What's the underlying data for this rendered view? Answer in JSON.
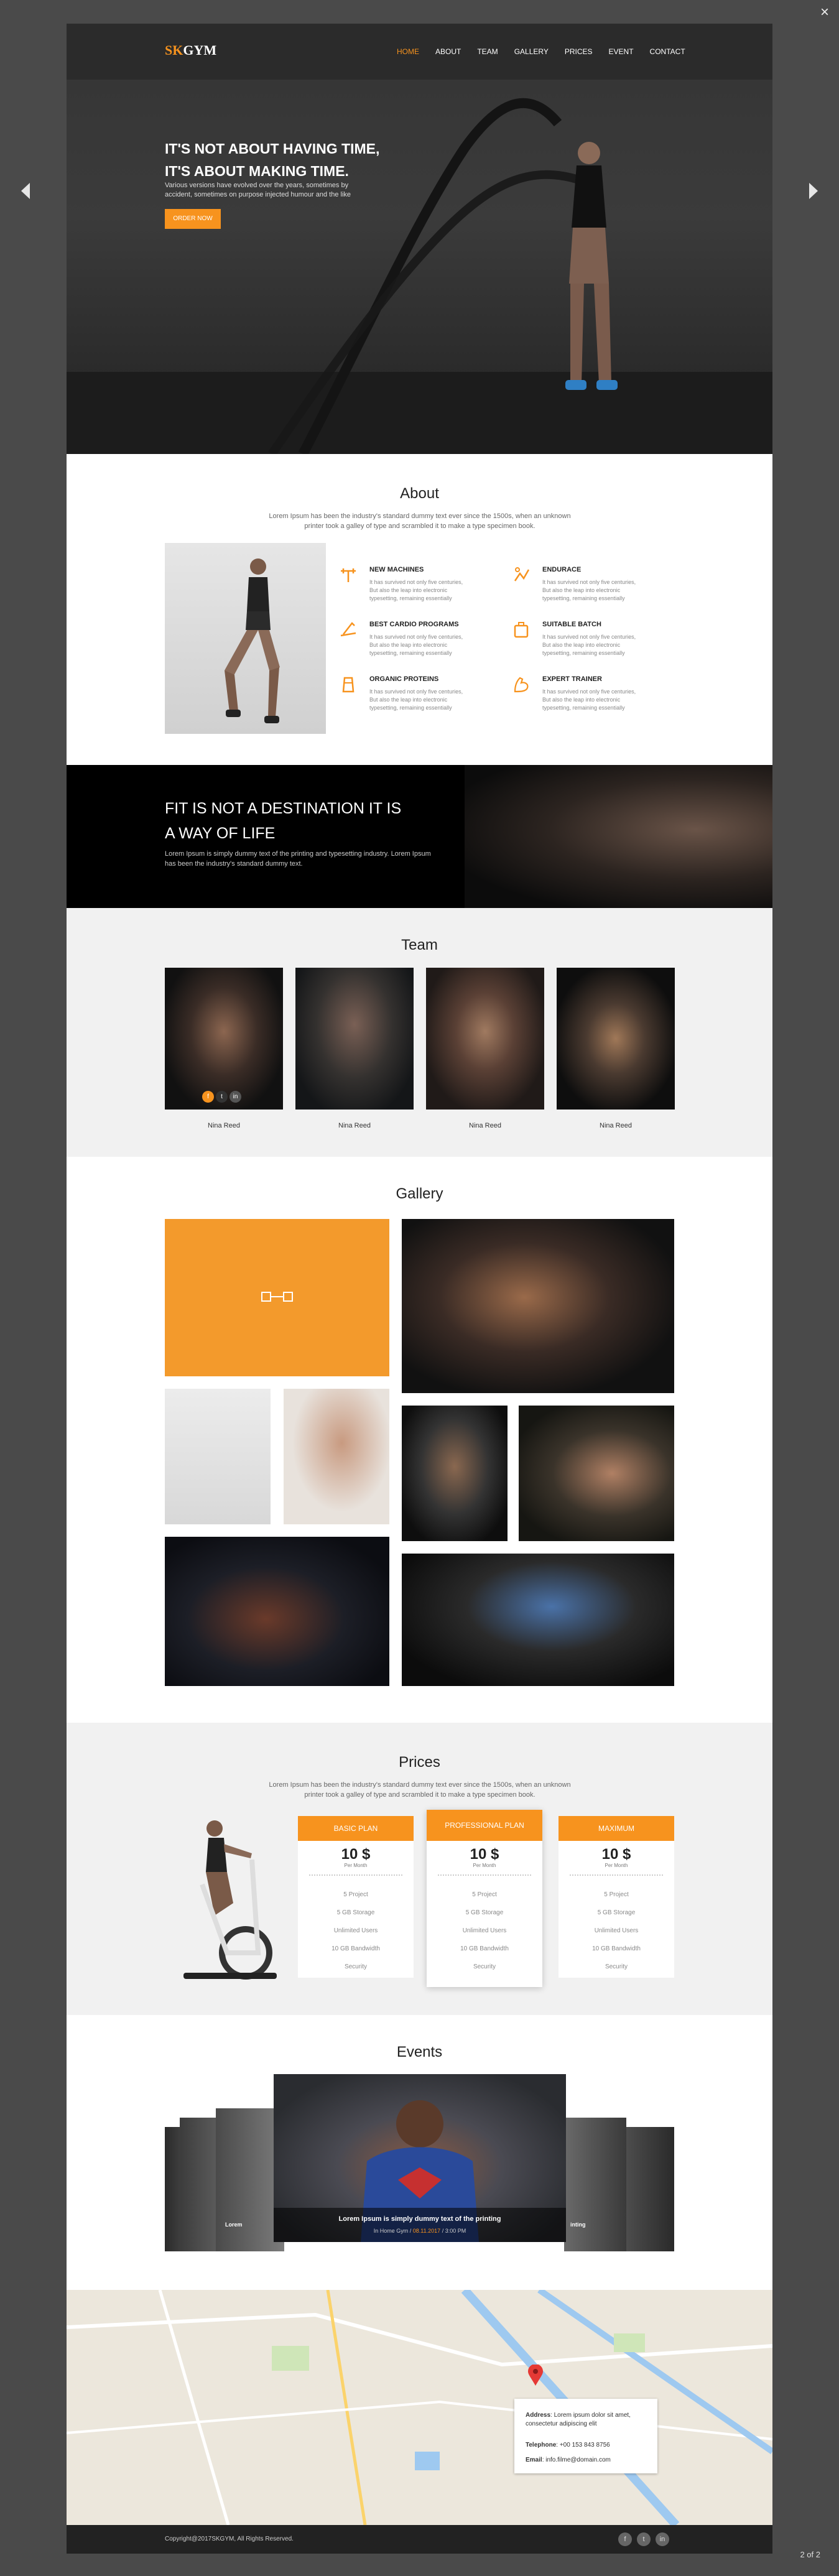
{
  "lightbox": {
    "close": "×",
    "counter": "2 of 2"
  },
  "nav": {
    "logo_accent": "SK",
    "logo_rest": "GYM",
    "items": [
      "HOME",
      "ABOUT",
      "TEAM",
      "GALLERY",
      "PRICES",
      "EVENT",
      "CONTACT"
    ],
    "active_index": 0
  },
  "hero": {
    "line1": "IT'S NOT ABOUT HAVING TIME,",
    "line2": "IT'S ABOUT MAKING TIME.",
    "subtitle": "Various versions have evolved over the years, sometimes by accident, sometimes on purpose injected humour and the like",
    "button": "ORDER NOW"
  },
  "about": {
    "title": "About",
    "desc": "Lorem Ipsum has been the industry's standard dummy text ever since the 1500s, when an unknown printer took a galley of type and scrambled it to make a type specimen book.",
    "features": [
      {
        "icon": "barbell-icon",
        "title": "NEW MACHINES",
        "text": "It has survived not only five centuries, But also the leap into electronic typesetting, remaining essentially"
      },
      {
        "icon": "muscle-arm-icon",
        "title": "ENDURACE",
        "text": "It has survived not only five centuries, But also the leap into electronic typesetting, remaining essentially"
      },
      {
        "icon": "treadmill-icon",
        "title": "BEST CARDIO PROGRAMS",
        "text": "It has survived not only five centuries, But also the leap into electronic typesetting, remaining essentially"
      },
      {
        "icon": "gym-bag-icon",
        "title": "SUITABLE BATCH",
        "text": "It has survived not only five centuries, But also the leap into electronic typesetting, remaining essentially"
      },
      {
        "icon": "protein-shaker-icon",
        "title": "ORGANIC PROTEINS",
        "text": "It has survived not only five centuries, But also the leap into electronic typesetting, remaining essentially"
      },
      {
        "icon": "flexed-bicep-icon",
        "title": "EXPERT TRAINER",
        "text": "It has survived not only five centuries, But also the leap into electronic typesetting, remaining essentially"
      }
    ]
  },
  "banner": {
    "line1": "FIT IS NOT A DESTINATION IT IS",
    "line2": "A WAY OF LIFE",
    "text": "Lorem Ipsum is simply dummy text of the printing and typesetting industry. Lorem Ipsum has been the industry's standard dummy text."
  },
  "team": {
    "title": "Team",
    "members": [
      {
        "name": "Nina Reed"
      },
      {
        "name": "Nina Reed"
      },
      {
        "name": "Nina Reed"
      },
      {
        "name": "Nina Reed"
      }
    ],
    "social": [
      "f",
      "t",
      "in"
    ]
  },
  "gallery": {
    "title": "Gallery"
  },
  "prices": {
    "title": "Prices",
    "desc": "Lorem Ipsum has been the industry's standard dummy text ever since the 1500s, when an unknown printer took a galley of type and scrambled it to make a type specimen book.",
    "plans": [
      {
        "name": "BASIC PLAN",
        "price": "10 $",
        "per": "Per Month",
        "features": [
          "5 Project",
          "5 GB Storage",
          "Unlimited Users",
          "10 GB Bandwidth",
          "Security"
        ]
      },
      {
        "name": "PROFESSIONAL PLAN",
        "price": "10 $",
        "per": "Per Month",
        "features": [
          "5 Project",
          "5 GB Storage",
          "Unlimited Users",
          "10 GB Bandwidth",
          "Security"
        ]
      },
      {
        "name": "MAXIMUM",
        "price": "10 $",
        "per": "Per Month",
        "features": [
          "5 Project",
          "5 GB Storage",
          "Unlimited Users",
          "10 GB Bandwidth",
          "Security"
        ]
      }
    ]
  },
  "events": {
    "title": "Events",
    "caption": "Lorem Ipsum is simply dummy text of the printing",
    "meta_prefix": "In Home Gym  /",
    "meta_date": "08.11.2017",
    "meta_suffix": "/  3:00 PM",
    "side_left": "Lorem",
    "side_right": "inting"
  },
  "contact": {
    "address_label": "Address",
    "address": ": Lorem ipsum dolor sit amet, consectetur adipiscing elit",
    "phone_label": "Telephone",
    "phone": ": +00 153 843 8756",
    "email_label": "Email",
    "email": ": info.filme@domain.com"
  },
  "footer": {
    "copyright": "Copyright@2017SKGYM, All Rights Reserved.",
    "social": [
      "f",
      "t",
      "in"
    ]
  },
  "colors": {
    "accent": "#f7931e",
    "dark": "#222222",
    "overlay": "#4a4a4a"
  }
}
